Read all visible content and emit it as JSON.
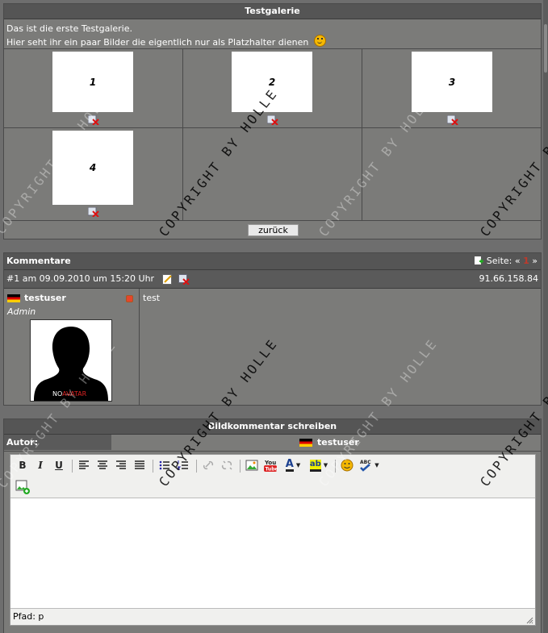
{
  "gallery": {
    "title": "Testgalerie",
    "desc_line1": "Das ist die erste Testgalerie.",
    "desc_line2": "Hier seht ihr ein paar Bilder die eigentlich nur als Platzhalter dienen",
    "thumbs": [
      "1",
      "2",
      "3",
      "4"
    ],
    "back_button": "zurück"
  },
  "comments": {
    "title": "Kommentare",
    "page_label": "Seite:",
    "page_prev": "«",
    "page_current": "1",
    "page_next": "»",
    "entry": {
      "header": "#1 am 09.09.2010 um 15:20 Uhr",
      "ip": "91.66.158.84",
      "username": "testuser",
      "rank": "Admin",
      "avatar_text_no": "NO",
      "avatar_text_avatar": "AVATAR",
      "text": "test"
    }
  },
  "write": {
    "title": "Bildkommentar schreiben",
    "author_label": "Autor:",
    "author_name": "testuser",
    "path_label": "Pfad: p"
  },
  "watermark": "COPYRIGHT BY HOLLE",
  "colors": {
    "accent_red": "#c0392b",
    "header_bg": "#555555",
    "panel_bg": "#7b7b79"
  }
}
